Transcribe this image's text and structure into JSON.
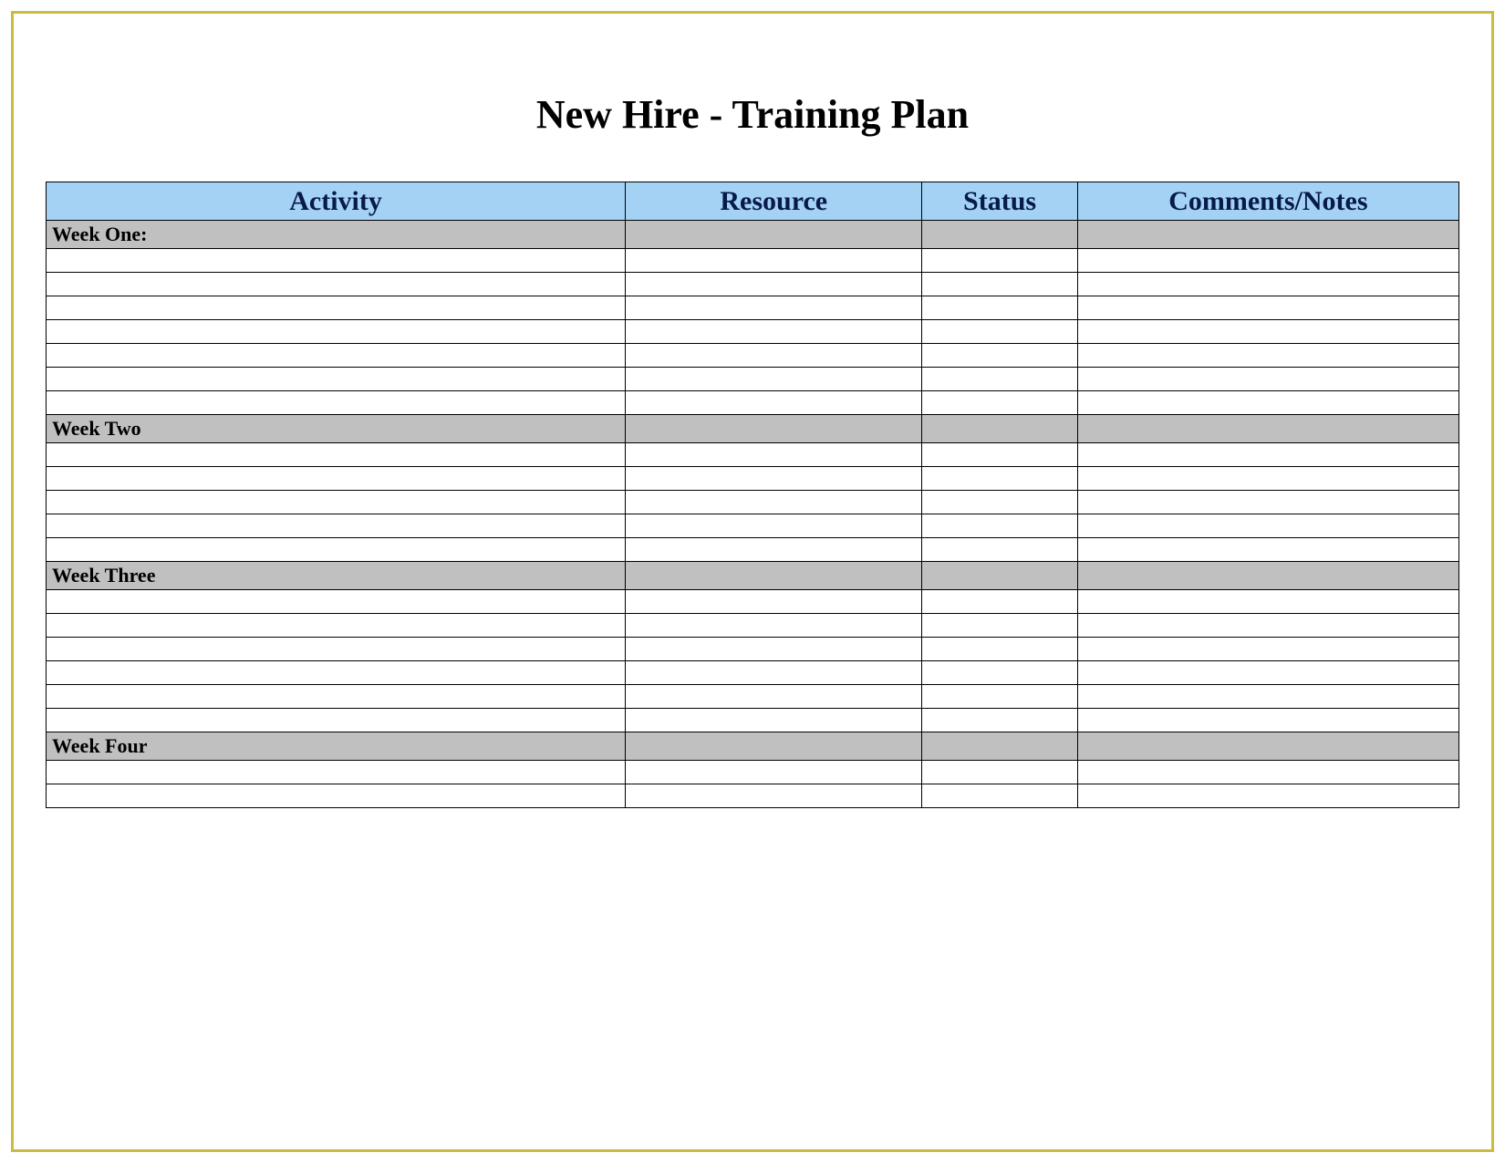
{
  "title": "New Hire - Training Plan",
  "columns": {
    "activity": "Activity",
    "resource": "Resource",
    "status": "Status",
    "comments": "Comments/Notes"
  },
  "sections": [
    {
      "label": "Week One:",
      "rows": 7
    },
    {
      "label": "Week Two",
      "rows": 5
    },
    {
      "label": "Week Three",
      "rows": 6
    },
    {
      "label": "Week Four",
      "rows": 2
    }
  ],
  "colors": {
    "border": "#cdbb3f",
    "header_bg": "#a4d2f5",
    "section_bg": "#c0c0c0"
  }
}
